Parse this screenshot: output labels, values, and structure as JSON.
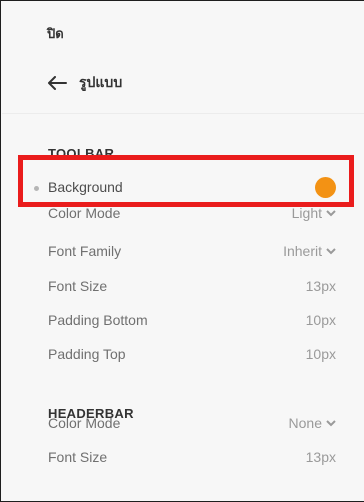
{
  "header": {
    "close_label": "ปิด"
  },
  "nav": {
    "back_title": "รูปแบบ"
  },
  "toolbar": {
    "section_title": "TOOLBAR",
    "rows": [
      {
        "label": "Background",
        "value": "",
        "swatch_color": "#f39214"
      },
      {
        "label": "Color Mode",
        "value": "Light"
      },
      {
        "label": "Font Family",
        "value": "Inherit"
      },
      {
        "label": "Font Size",
        "value": "13px"
      },
      {
        "label": "Padding Bottom",
        "value": "10px"
      },
      {
        "label": "Padding Top",
        "value": "10px"
      }
    ]
  },
  "headerbar": {
    "section_title": "HEADERBAR",
    "rows": [
      {
        "label": "Color Mode",
        "value": "None"
      },
      {
        "label": "Font Size",
        "value": "13px"
      }
    ]
  },
  "colors": {
    "highlight_border": "#ea1c1c",
    "swatch": "#f39214"
  }
}
